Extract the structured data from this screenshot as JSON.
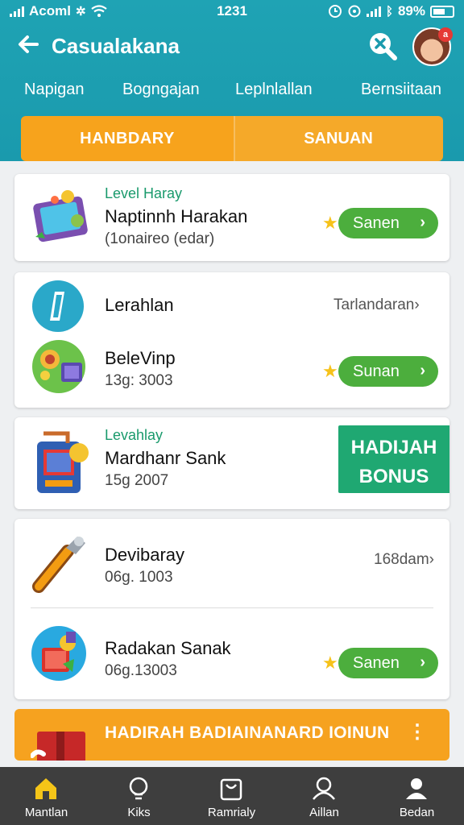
{
  "status_bar": {
    "carrier": "Acoml",
    "time": "1231",
    "battery": "89%"
  },
  "header": {
    "title": "Casualakana",
    "avatar_badge": "a",
    "nav": [
      "Napigan",
      "Bogngajan",
      "Leplnlallan",
      "Bernsiitaan"
    ],
    "segments": [
      "HANBDARY",
      "SANUAN"
    ]
  },
  "cards": {
    "c1": {
      "kicker": "Level Haray",
      "name": "Naptinnh Harakan",
      "sub": "(1onaireo (edar)",
      "button": "Sanen"
    },
    "c2a": {
      "name": "Lerahlan",
      "side": "Tarlandaran"
    },
    "c2b": {
      "name": "BeleVinp",
      "sub": "13g: 3003",
      "button": "Sunan"
    },
    "c3": {
      "kicker": "Levahlay",
      "name": "Mardhanr Sank",
      "sub": "15g 2007",
      "bonus_line1": "HADIJAH",
      "bonus_line2": "BONUS"
    },
    "c4a": {
      "name": "Devibaray",
      "sub": "06g. 1003",
      "side": "168dam"
    },
    "c4b": {
      "name": "Radakan Sanak",
      "sub": "06g.13003",
      "button": "Sanen"
    }
  },
  "promo": {
    "text": "HADIRAH BADIAINANARD IOINUN"
  },
  "bottom_nav": [
    "Mantlan",
    "Kiks",
    "Ramrialy",
    "Aillan",
    "Bedan"
  ],
  "colors": {
    "header": "#1fa3b4",
    "accent_orange": "#f7a31c",
    "button_green": "#4cae3d",
    "bonus_green": "#1fa872",
    "bottom_nav": "#3e3e3e"
  }
}
